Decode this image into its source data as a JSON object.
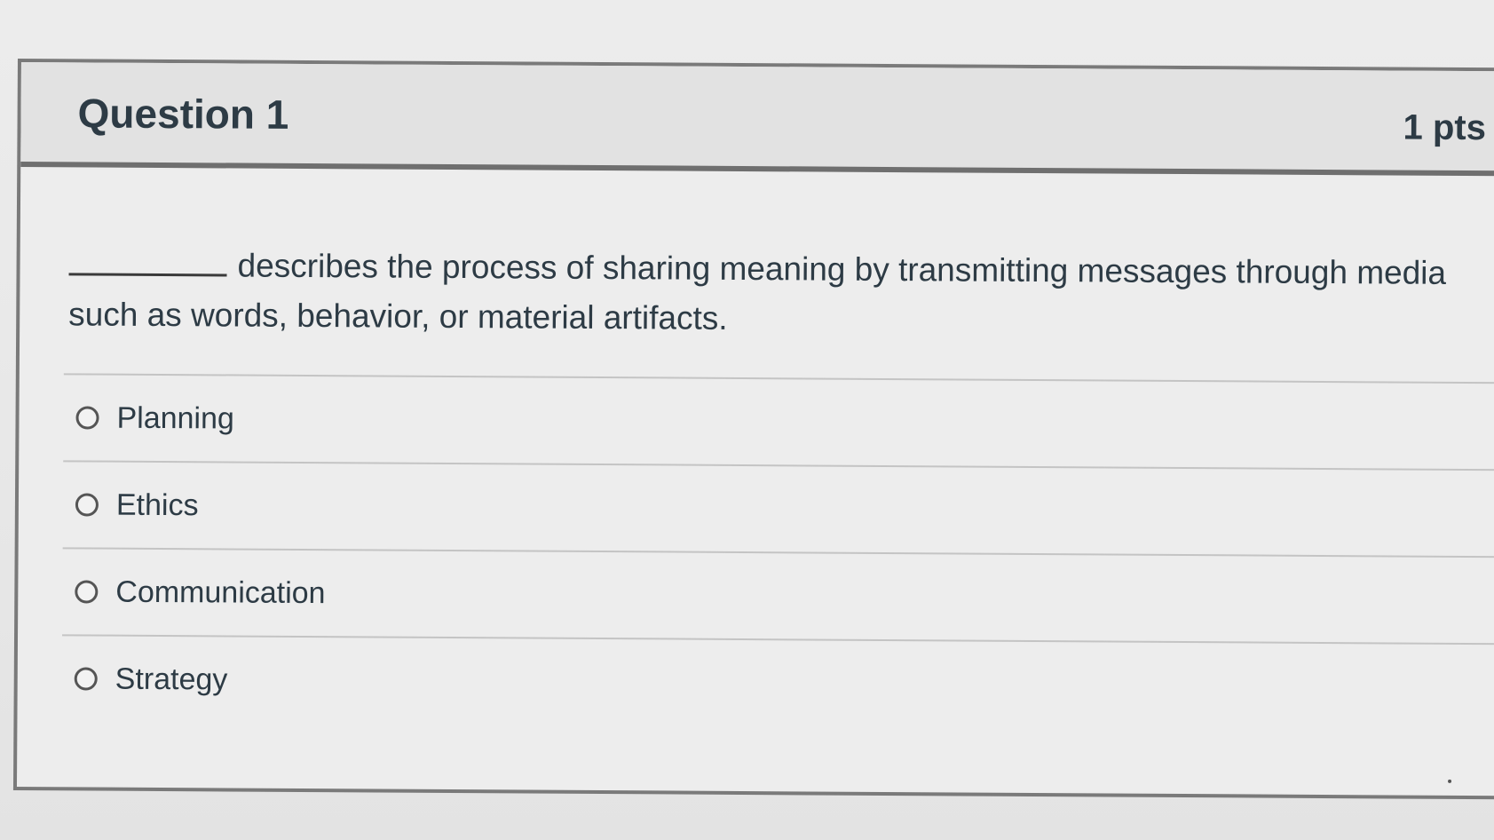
{
  "question": {
    "title": "Question 1",
    "points": "1 pts",
    "text": "describes the process of sharing meaning by transmitting messages through media such as words, behavior, or material artifacts."
  },
  "answers": [
    {
      "label": "Planning",
      "selected": false
    },
    {
      "label": "Ethics",
      "selected": false
    },
    {
      "label": "Communication",
      "selected": false
    },
    {
      "label": "Strategy",
      "selected": false
    }
  ],
  "colors": {
    "text": "#2d3b45",
    "header_bg": "#e2e2e2",
    "border": "#7a7a7a"
  }
}
